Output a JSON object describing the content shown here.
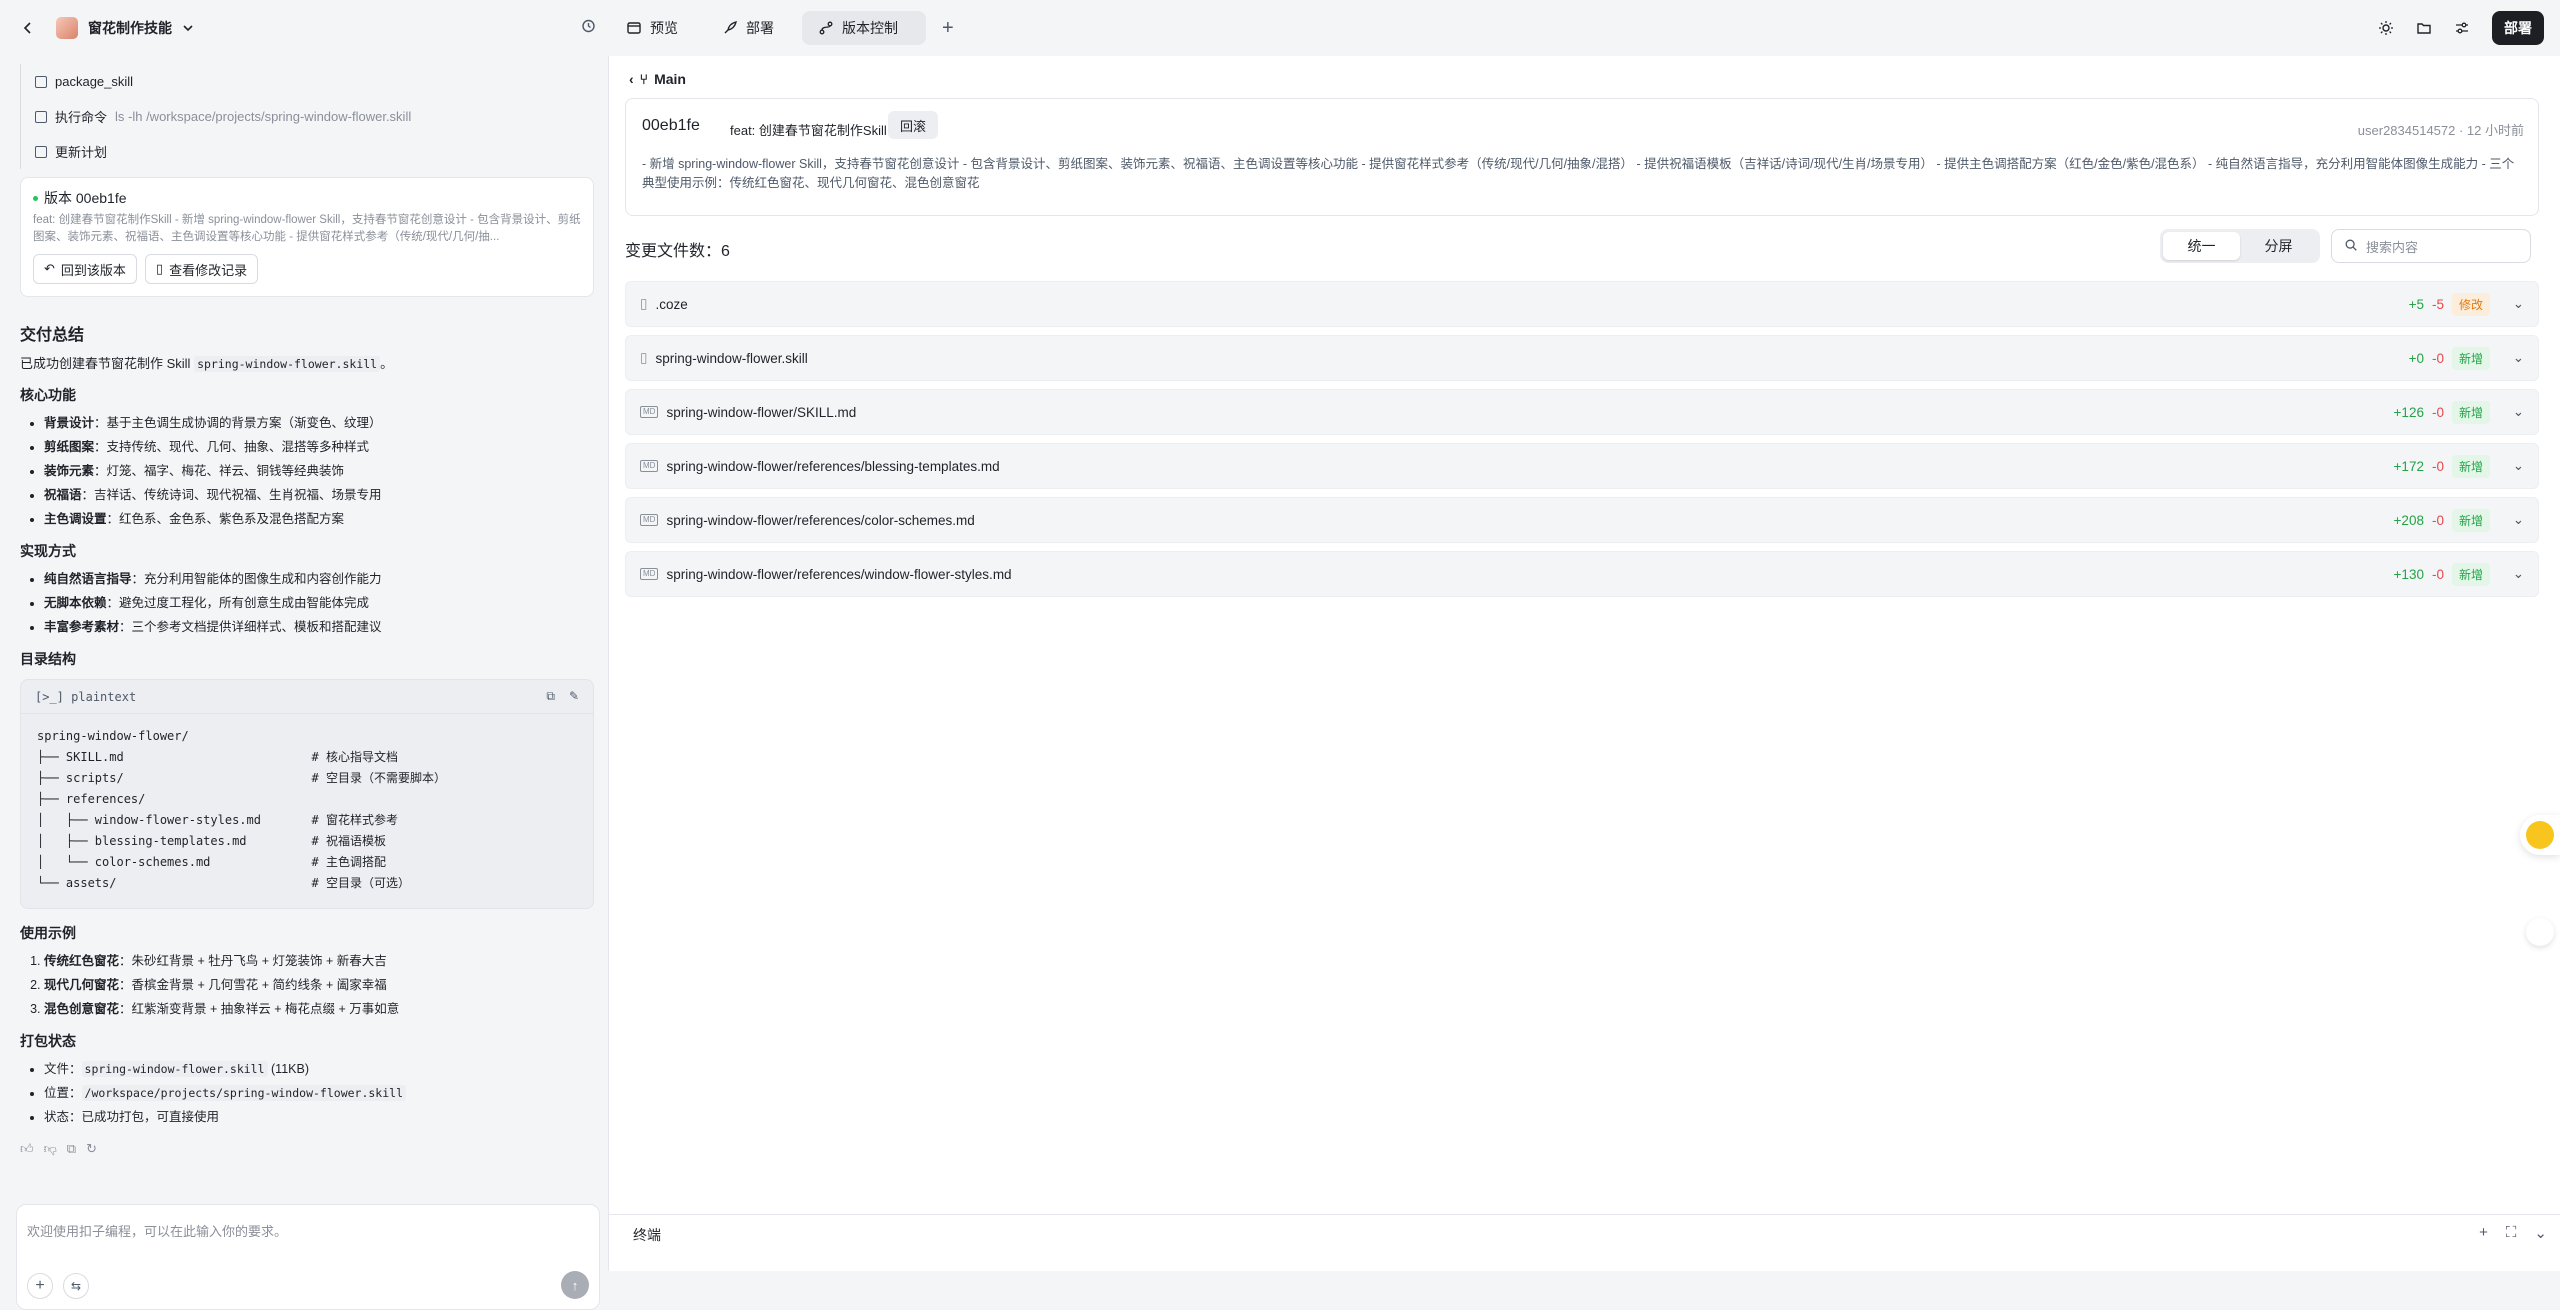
{
  "project": {
    "name": "窗花制作技能"
  },
  "tabs": [
    {
      "label": "预览"
    },
    {
      "label": "部署"
    },
    {
      "label": "版本控制"
    }
  ],
  "deploy_label": "部署",
  "steps": [
    {
      "label": "package_skill",
      "cmd": ""
    },
    {
      "label": "执行命令",
      "cmd": "ls -lh /workspace/projects/spring-window-flower.skill"
    },
    {
      "label": "更新计划",
      "cmd": ""
    }
  ],
  "version_card": {
    "title": "版本 00eb1fe",
    "desc": "feat: 创建春节窗花制作Skill - 新增 spring-window-flower Skill，支持春节窗花创意设计 - 包含背景设计、剪纸图案、装饰元素、祝福语、主色调设置等核心功能 - 提供窗花样式参考（传统/现代/几何/抽...",
    "back_label": "回到该版本",
    "log_label": "查看修改记录"
  },
  "summary": {
    "title": "交付总结",
    "intro_prefix": "已成功创建春节窗花制作 Skill",
    "intro_code": "spring-window-flower.skill",
    "intro_suffix": "。",
    "core_title": "核心功能",
    "core": [
      {
        "k": "背景设计",
        "v": "：基于主色调生成协调的背景方案（渐变色、纹理）"
      },
      {
        "k": "剪纸图案",
        "v": "：支持传统、现代、几何、抽象、混搭等多种样式"
      },
      {
        "k": "装饰元素",
        "v": "：灯笼、福字、梅花、祥云、铜钱等经典装饰"
      },
      {
        "k": "祝福语",
        "v": "：吉祥话、传统诗词、现代祝福、生肖祝福、场景专用"
      },
      {
        "k": "主色调设置",
        "v": "：红色系、金色系、紫色系及混色搭配方案"
      }
    ],
    "impl_title": "实现方式",
    "impl": [
      {
        "k": "纯自然语言指导",
        "v": "：充分利用智能体的图像生成和内容创作能力"
      },
      {
        "k": "无脚本依赖",
        "v": "：避免过度工程化，所有创意生成由智能体完成"
      },
      {
        "k": "丰富参考素材",
        "v": "：三个参考文档提供详细样式、模板和搭配建议"
      }
    ],
    "dir_title": "目录结构",
    "code_lang": "plaintext",
    "code": "spring-window-flower/\n├── SKILL.md                          # 核心指导文档\n├── scripts/                          # 空目录（不需要脚本）\n├── references/\n│   ├── window-flower-styles.md       # 窗花样式参考\n│   ├── blessing-templates.md         # 祝福语模板\n│   └── color-schemes.md              # 主色调搭配\n└── assets/                           # 空目录（可选）",
    "usage_title": "使用示例",
    "usage": [
      {
        "k": "传统红色窗花",
        "v": "：朱砂红背景 + 牡丹飞鸟 + 灯笼装饰 + 新春大吉"
      },
      {
        "k": "现代几何窗花",
        "v": "：香槟金背景 + 几何雪花 + 简约线条 + 阖家幸福"
      },
      {
        "k": "混色创意窗花",
        "v": "：红紫渐变背景 + 抽象祥云 + 梅花点缀 + 万事如意"
      }
    ],
    "pack_title": "打包状态",
    "pack": [
      {
        "k": "文件：",
        "code": "spring-window-flower.skill",
        "v": " (11KB)"
      },
      {
        "k": "位置：",
        "code": "/workspace/projects/spring-window-flower.skill",
        "v": ""
      },
      {
        "k": "状态：",
        "code": "",
        "v": "已成功打包，可直接使用"
      }
    ]
  },
  "input": {
    "placeholder": "欢迎使用扣子编程，可以在此输入你的要求。"
  },
  "branch": "Main",
  "commit": {
    "hash": "00eb1fe",
    "msg": "feat: 创建春节窗花制作Skill",
    "revert": "回滚",
    "meta": "user2834514572 · 12 小时前",
    "body": "- 新增 spring-window-flower Skill，支持春节窗花创意设计 - 包含背景设计、剪纸图案、装饰元素、祝福语、主色调设置等核心功能 - 提供窗花样式参考（传统/现代/几何/抽象/混搭） - 提供祝福语模板（吉祥话/诗词/现代/生肖/场景专用） - 提供主色调搭配方案（红色/金色/紫色/混色系） - 纯自然语言指导，充分利用智能体图像生成能力 - 三个典型使用示例：传统红色窗花、现代几何窗花、混色创意窗花"
  },
  "changes": {
    "label": "变更文件数：6",
    "view_unified": "统一",
    "view_split": "分屏",
    "search_placeholder": "搜索内容",
    "files": [
      {
        "name": ".coze",
        "icon": "file-icon",
        "add": "+5",
        "del": "-5",
        "status": "修改",
        "kind": "mod"
      },
      {
        "name": "spring-window-flower.skill",
        "icon": "file-icon",
        "add": "+0",
        "del": "-0",
        "status": "新增",
        "kind": "new"
      },
      {
        "name": "spring-window-flower/SKILL.md",
        "icon": "markdown-icon",
        "add": "+126",
        "del": "-0",
        "status": "新增",
        "kind": "new"
      },
      {
        "name": "spring-window-flower/references/blessing-templates.md",
        "icon": "markdown-icon",
        "add": "+172",
        "del": "-0",
        "status": "新增",
        "kind": "new"
      },
      {
        "name": "spring-window-flower/references/color-schemes.md",
        "icon": "markdown-icon",
        "add": "+208",
        "del": "-0",
        "status": "新增",
        "kind": "new"
      },
      {
        "name": "spring-window-flower/references/window-flower-styles.md",
        "icon": "markdown-icon",
        "add": "+130",
        "del": "-0",
        "status": "新增",
        "kind": "new"
      }
    ]
  },
  "terminal": {
    "title": "终端"
  }
}
